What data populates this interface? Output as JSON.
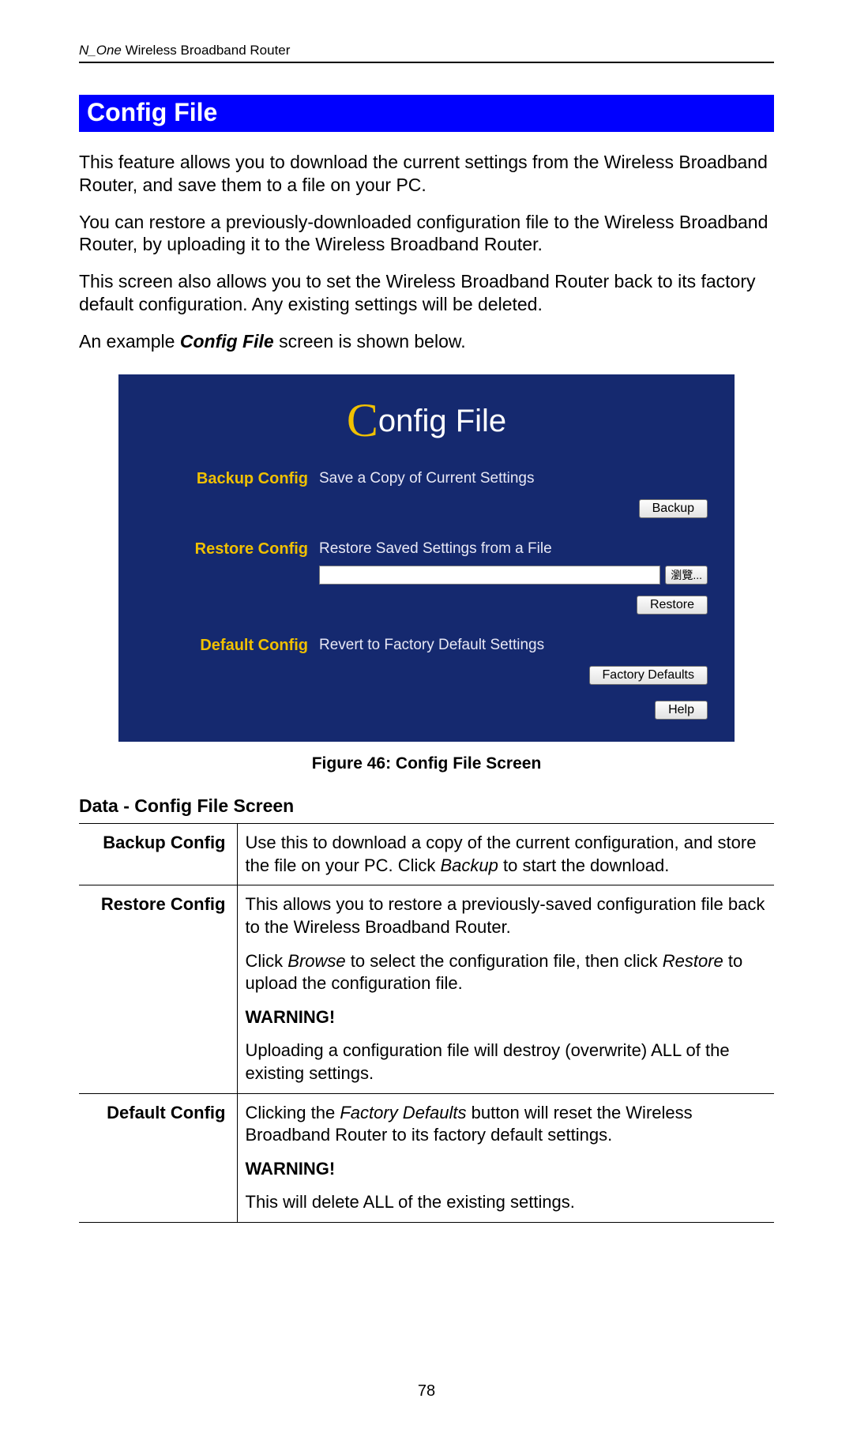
{
  "header": {
    "product_italic": "N_One",
    "product_rest": " Wireless Broadband Router"
  },
  "section_title": "Config File",
  "paragraphs": {
    "p1": "This feature allows you to download the current settings from the Wireless Broadband Router, and save them to a file on your PC.",
    "p2": "You can restore a previously-downloaded configuration file to the Wireless Broadband Router, by uploading it to the Wireless Broadband Router.",
    "p3": "This screen also allows you to set the Wireless Broadband Router back to its factory default configuration. Any existing settings will be deleted.",
    "p4_a": "An example ",
    "p4_bi": "Config File",
    "p4_b": " screen is shown below."
  },
  "panel": {
    "title_rest": "onfig File",
    "rows": {
      "backup": {
        "label": "Backup Config",
        "desc": "Save a Copy of Current Settings",
        "button": "Backup"
      },
      "restore": {
        "label": "Restore Config",
        "desc": "Restore Saved Settings from a File",
        "browse": "瀏覽...",
        "button": "Restore"
      },
      "default": {
        "label": "Default Config",
        "desc": "Revert to Factory Default Settings",
        "button": "Factory Defaults"
      }
    },
    "help_button": "Help"
  },
  "figure_caption": "Figure 46: Config File Screen",
  "data_heading": "Data - Config File Screen",
  "table": {
    "backup": {
      "label": "Backup Config",
      "text_a": "Use this to download a copy of the current configuration, and store the file on your PC. Click ",
      "text_it1": "Backup",
      "text_b": " to start the download."
    },
    "restore": {
      "label": "Restore Config",
      "p1": "This allows you to restore a previously-saved configuration file back to the Wireless Broadband Router.",
      "p2_a": "Click ",
      "p2_it1": "Browse",
      "p2_b": " to select the configuration file, then click ",
      "p2_it2": "Restore",
      "p2_c": " to upload the configuration file.",
      "warn_label": "WARNING!",
      "warn_text": "Uploading a configuration file will destroy (overwrite) ALL of the existing settings."
    },
    "default": {
      "label": "Default Config",
      "p1_a": "Clicking the ",
      "p1_it1": "Factory Defaults",
      "p1_b": " button will reset the Wireless Broadband Router to its factory default settings.",
      "warn_label": "WARNING!",
      "warn_text": "This will delete ALL of the existing settings."
    }
  },
  "page_number": "78"
}
